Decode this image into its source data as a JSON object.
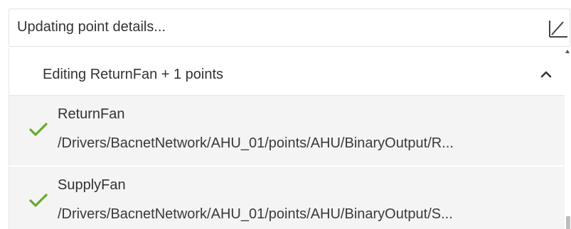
{
  "header": {
    "title": "Updating point details...",
    "expand_icon": "expand-diagonal-icon"
  },
  "section": {
    "title": "Editing ReturnFan + 1 points",
    "collapse_icon": "chevron-up-icon"
  },
  "points": [
    {
      "name": "ReturnFan",
      "path": "/Drivers/BacnetNetwork/AHU_01/points/AHU/BinaryOutput/R...",
      "status_icon": "checkmark-icon",
      "status_color": "#6aaa2a"
    },
    {
      "name": "SupplyFan",
      "path": "/Drivers/BacnetNetwork/AHU_01/points/AHU/BinaryOutput/S...",
      "status_icon": "checkmark-icon",
      "status_color": "#6aaa2a"
    }
  ],
  "colors": {
    "item_background": "#f3f4f3",
    "border": "#e3e3e3",
    "success": "#6aaa2a"
  }
}
